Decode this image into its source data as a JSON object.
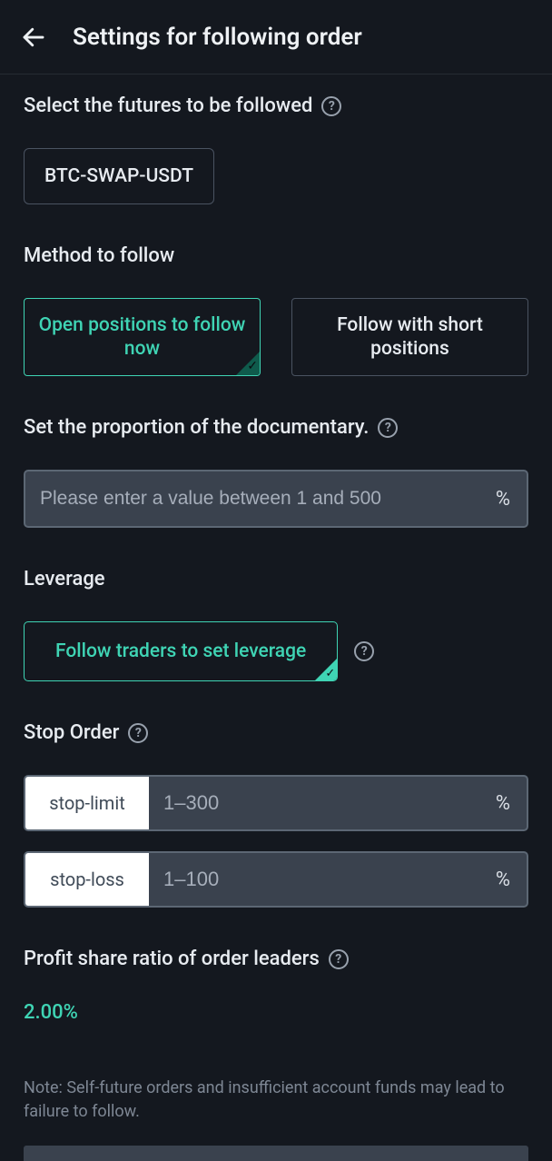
{
  "header": {
    "title": "Settings for following order"
  },
  "futures": {
    "label": "Select the futures to be followed",
    "chip": "BTC-SWAP-USDT"
  },
  "method": {
    "label": "Method to follow",
    "option_open": "Open positions to follow now",
    "option_short": "Follow with short positions"
  },
  "proportion": {
    "label": "Set the proportion of the documentary.",
    "placeholder": "Please enter a value between 1 and 500",
    "suffix": "%"
  },
  "leverage": {
    "label": "Leverage",
    "button": "Follow traders to set leverage"
  },
  "stop": {
    "label": "Stop Order",
    "limit_label": "stop-limit",
    "limit_placeholder": "1–300",
    "loss_label": "stop-loss",
    "loss_placeholder": "1–100",
    "suffix": "%"
  },
  "profit": {
    "label": "Profit share ratio of order leaders",
    "value": "2.00%"
  },
  "note": "Note: Self-future orders and insufficient account funds may lead to failure to follow."
}
